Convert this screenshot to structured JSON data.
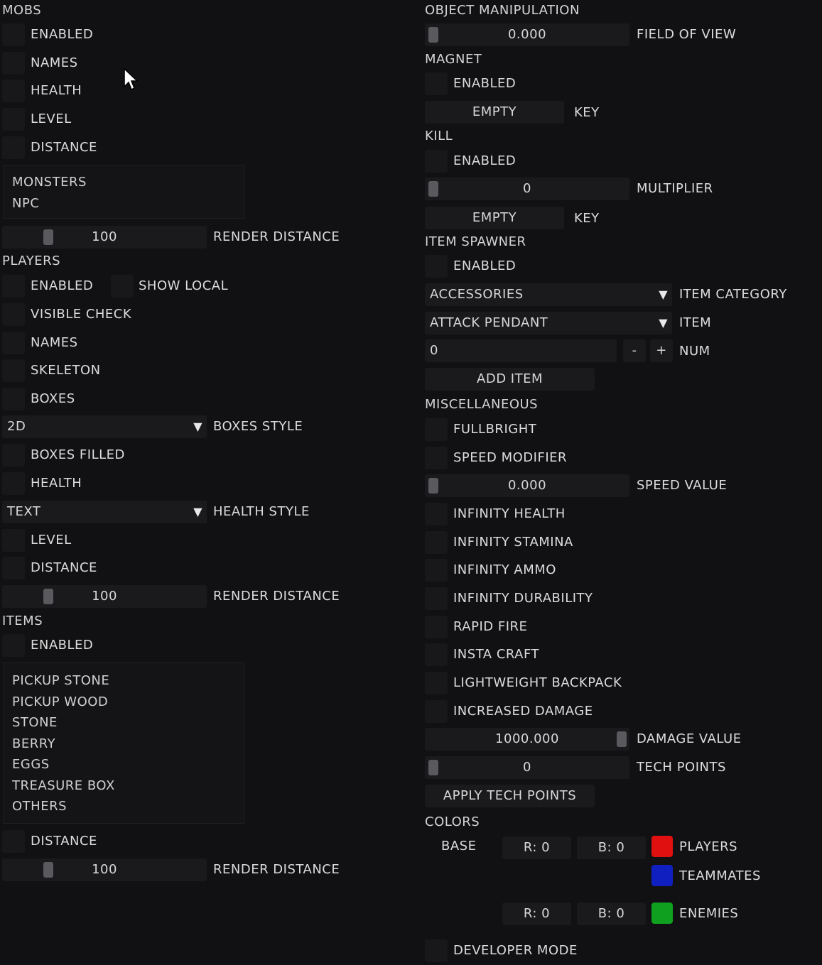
{
  "mobs": {
    "header": "MOBS",
    "enabled": "ENABLED",
    "names": "NAMES",
    "health": "HEALTH",
    "level": "LEVEL",
    "distance": "DISTANCE",
    "filter_list": [
      "MONSTERS",
      "NPC"
    ],
    "render_distance_value": "100",
    "render_distance_label": "RENDER DISTANCE"
  },
  "players": {
    "header": "PLAYERS",
    "enabled": "ENABLED",
    "show_local": "SHOW LOCAL",
    "visible_check": "VISIBLE CHECK",
    "names": "NAMES",
    "skeleton": "SKELETON",
    "boxes": "BOXES",
    "boxes_style_value": "2D",
    "boxes_style_label": "BOXES STYLE",
    "boxes_filled": "BOXES FILLED",
    "health": "HEALTH",
    "health_style_value": "TEXT",
    "health_style_label": "HEALTH STYLE",
    "level": "LEVEL",
    "distance": "DISTANCE",
    "render_distance_value": "100",
    "render_distance_label": "RENDER DISTANCE"
  },
  "items": {
    "header": "ITEMS",
    "enabled": "ENABLED",
    "filter_list": [
      "PICKUP STONE",
      "PICKUP WOOD",
      "STONE",
      "BERRY",
      "EGGS",
      "TREASURE BOX",
      "OTHERS"
    ],
    "distance": "DISTANCE",
    "render_distance_value": "100",
    "render_distance_label": "RENDER DISTANCE"
  },
  "object_manipulation": {
    "header": "OBJECT MANIPULATION",
    "fov_value": "0.000",
    "fov_label": "FIELD OF VIEW"
  },
  "magnet": {
    "header": "MAGNET",
    "enabled": "ENABLED",
    "key_value": "EMPTY",
    "key_label": "KEY"
  },
  "kill": {
    "header": "KILL",
    "enabled": "ENABLED",
    "multiplier_value": "0",
    "multiplier_label": "MULTIPLIER",
    "key_value": "EMPTY",
    "key_label": "KEY"
  },
  "item_spawner": {
    "header": "ITEM SPAWNER",
    "enabled": "ENABLED",
    "category_value": "ACCESSORIES",
    "category_label": "ITEM CATEGORY",
    "item_value": "ATTACK PENDANT",
    "item_label": "ITEM",
    "num_value": "0",
    "minus": "-",
    "plus": "+",
    "num_label": "NUM",
    "add_item": "ADD ITEM"
  },
  "misc": {
    "header": "MISCELLANEOUS",
    "fullbright": "FULLBRIGHT",
    "speed_modifier": "SPEED MODIFIER",
    "speed_value": "0.000",
    "speed_label": "SPEED VALUE",
    "infinity_health": "INFINITY HEALTH",
    "infinity_stamina": "INFINITY STAMINA",
    "infinity_ammo": "INFINITY AMMO",
    "infinity_durability": "INFINITY DURABILITY",
    "rapid_fire": "RAPID FIRE",
    "insta_craft": "INSTA CRAFT",
    "lightweight_backpack": "LIGHTWEIGHT BACKPACK",
    "increased_damage": "INCREASED DAMAGE",
    "damage_value": "1000.000",
    "damage_label": "DAMAGE VALUE",
    "tech_points_value": "0",
    "tech_points_label": "TECH POINTS",
    "apply_tech_points": "APPLY TECH POINTS"
  },
  "colors": {
    "header": "COLORS",
    "base": "BASE",
    "row1_r": "R:  0",
    "row1_b": "B:  0",
    "players": "PLAYERS",
    "players_color": "#e01010",
    "teammates": "TEAMMATES",
    "teammates_color": "#1020c0",
    "row2_r": "R:  0",
    "row2_b": "B:  0",
    "enemies": "ENEMIES",
    "enemies_color": "#10a020"
  },
  "developer_mode": "DEVELOPER MODE"
}
